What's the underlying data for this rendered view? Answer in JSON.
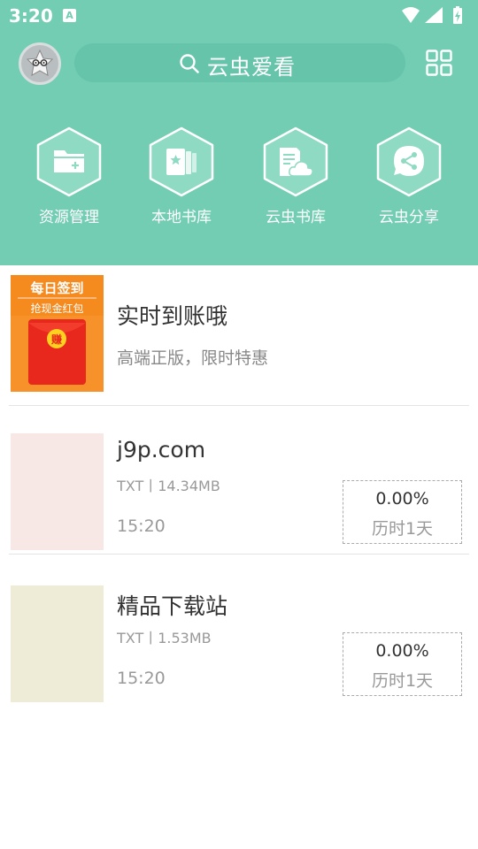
{
  "status_bar": {
    "time": "3:20",
    "notification_letter": "A"
  },
  "header": {
    "search_placeholder": "云虫爱看"
  },
  "features": [
    {
      "label": "资源管理",
      "icon": "folder-add-icon"
    },
    {
      "label": "本地书库",
      "icon": "local-books-icon"
    },
    {
      "label": "云虫书库",
      "icon": "cloud-library-icon"
    },
    {
      "label": "云虫分享",
      "icon": "share-icon"
    }
  ],
  "ad": {
    "banner_title": "每日签到",
    "banner_subtitle": "抢现金红包",
    "envelope_char": "赚",
    "title": "实时到账哦",
    "subtitle": "高端正版，限时特惠"
  },
  "books": [
    {
      "title": "j9p.com",
      "meta": "TXT丨14.34MB",
      "time": "15:20",
      "progress": "0.00%",
      "duration": "历时1天",
      "cover_color": "#f7e8e5"
    },
    {
      "title": "精品下载站",
      "meta": "TXT丨1.53MB",
      "time": "15:20",
      "progress": "0.00%",
      "duration": "历时1天",
      "cover_color": "#eeecd6"
    }
  ],
  "colors": {
    "header": "#72cdb3",
    "hex_fill": "#8fdac3",
    "ad_orange": "#f7912a",
    "ad_red": "#e8271d"
  }
}
